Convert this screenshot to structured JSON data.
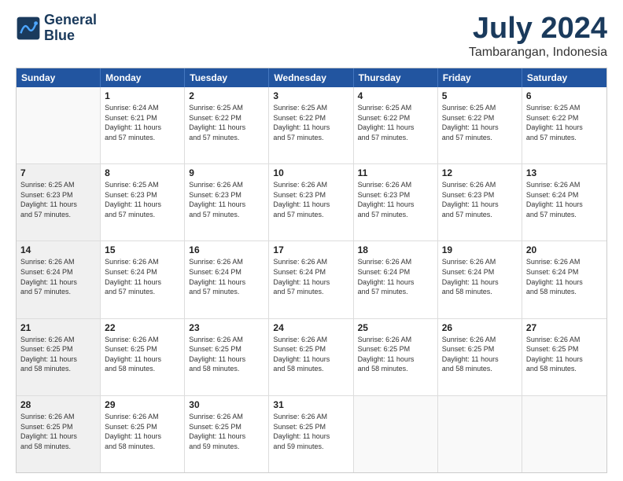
{
  "header": {
    "logo_line1": "General",
    "logo_line2": "Blue",
    "title": "July 2024",
    "subtitle": "Tambarangan, Indonesia"
  },
  "calendar": {
    "weekdays": [
      "Sunday",
      "Monday",
      "Tuesday",
      "Wednesday",
      "Thursday",
      "Friday",
      "Saturday"
    ],
    "rows": [
      [
        {
          "day": "",
          "text": "",
          "empty": true
        },
        {
          "day": "1",
          "text": "Sunrise: 6:24 AM\nSunset: 6:21 PM\nDaylight: 11 hours\nand 57 minutes."
        },
        {
          "day": "2",
          "text": "Sunrise: 6:25 AM\nSunset: 6:22 PM\nDaylight: 11 hours\nand 57 minutes."
        },
        {
          "day": "3",
          "text": "Sunrise: 6:25 AM\nSunset: 6:22 PM\nDaylight: 11 hours\nand 57 minutes."
        },
        {
          "day": "4",
          "text": "Sunrise: 6:25 AM\nSunset: 6:22 PM\nDaylight: 11 hours\nand 57 minutes."
        },
        {
          "day": "5",
          "text": "Sunrise: 6:25 AM\nSunset: 6:22 PM\nDaylight: 11 hours\nand 57 minutes."
        },
        {
          "day": "6",
          "text": "Sunrise: 6:25 AM\nSunset: 6:22 PM\nDaylight: 11 hours\nand 57 minutes."
        }
      ],
      [
        {
          "day": "7",
          "text": "Sunrise: 6:25 AM\nSunset: 6:23 PM\nDaylight: 11 hours\nand 57 minutes.",
          "shaded": true
        },
        {
          "day": "8",
          "text": "Sunrise: 6:25 AM\nSunset: 6:23 PM\nDaylight: 11 hours\nand 57 minutes."
        },
        {
          "day": "9",
          "text": "Sunrise: 6:26 AM\nSunset: 6:23 PM\nDaylight: 11 hours\nand 57 minutes."
        },
        {
          "day": "10",
          "text": "Sunrise: 6:26 AM\nSunset: 6:23 PM\nDaylight: 11 hours\nand 57 minutes."
        },
        {
          "day": "11",
          "text": "Sunrise: 6:26 AM\nSunset: 6:23 PM\nDaylight: 11 hours\nand 57 minutes."
        },
        {
          "day": "12",
          "text": "Sunrise: 6:26 AM\nSunset: 6:23 PM\nDaylight: 11 hours\nand 57 minutes."
        },
        {
          "day": "13",
          "text": "Sunrise: 6:26 AM\nSunset: 6:24 PM\nDaylight: 11 hours\nand 57 minutes."
        }
      ],
      [
        {
          "day": "14",
          "text": "Sunrise: 6:26 AM\nSunset: 6:24 PM\nDaylight: 11 hours\nand 57 minutes.",
          "shaded": true
        },
        {
          "day": "15",
          "text": "Sunrise: 6:26 AM\nSunset: 6:24 PM\nDaylight: 11 hours\nand 57 minutes."
        },
        {
          "day": "16",
          "text": "Sunrise: 6:26 AM\nSunset: 6:24 PM\nDaylight: 11 hours\nand 57 minutes."
        },
        {
          "day": "17",
          "text": "Sunrise: 6:26 AM\nSunset: 6:24 PM\nDaylight: 11 hours\nand 57 minutes."
        },
        {
          "day": "18",
          "text": "Sunrise: 6:26 AM\nSunset: 6:24 PM\nDaylight: 11 hours\nand 57 minutes."
        },
        {
          "day": "19",
          "text": "Sunrise: 6:26 AM\nSunset: 6:24 PM\nDaylight: 11 hours\nand 58 minutes."
        },
        {
          "day": "20",
          "text": "Sunrise: 6:26 AM\nSunset: 6:24 PM\nDaylight: 11 hours\nand 58 minutes."
        }
      ],
      [
        {
          "day": "21",
          "text": "Sunrise: 6:26 AM\nSunset: 6:25 PM\nDaylight: 11 hours\nand 58 minutes.",
          "shaded": true
        },
        {
          "day": "22",
          "text": "Sunrise: 6:26 AM\nSunset: 6:25 PM\nDaylight: 11 hours\nand 58 minutes."
        },
        {
          "day": "23",
          "text": "Sunrise: 6:26 AM\nSunset: 6:25 PM\nDaylight: 11 hours\nand 58 minutes."
        },
        {
          "day": "24",
          "text": "Sunrise: 6:26 AM\nSunset: 6:25 PM\nDaylight: 11 hours\nand 58 minutes."
        },
        {
          "day": "25",
          "text": "Sunrise: 6:26 AM\nSunset: 6:25 PM\nDaylight: 11 hours\nand 58 minutes."
        },
        {
          "day": "26",
          "text": "Sunrise: 6:26 AM\nSunset: 6:25 PM\nDaylight: 11 hours\nand 58 minutes."
        },
        {
          "day": "27",
          "text": "Sunrise: 6:26 AM\nSunset: 6:25 PM\nDaylight: 11 hours\nand 58 minutes."
        }
      ],
      [
        {
          "day": "28",
          "text": "Sunrise: 6:26 AM\nSunset: 6:25 PM\nDaylight: 11 hours\nand 58 minutes.",
          "shaded": true
        },
        {
          "day": "29",
          "text": "Sunrise: 6:26 AM\nSunset: 6:25 PM\nDaylight: 11 hours\nand 58 minutes."
        },
        {
          "day": "30",
          "text": "Sunrise: 6:26 AM\nSunset: 6:25 PM\nDaylight: 11 hours\nand 59 minutes."
        },
        {
          "day": "31",
          "text": "Sunrise: 6:26 AM\nSunset: 6:25 PM\nDaylight: 11 hours\nand 59 minutes."
        },
        {
          "day": "",
          "text": "",
          "empty": true
        },
        {
          "day": "",
          "text": "",
          "empty": true
        },
        {
          "day": "",
          "text": "",
          "empty": true
        }
      ]
    ]
  }
}
